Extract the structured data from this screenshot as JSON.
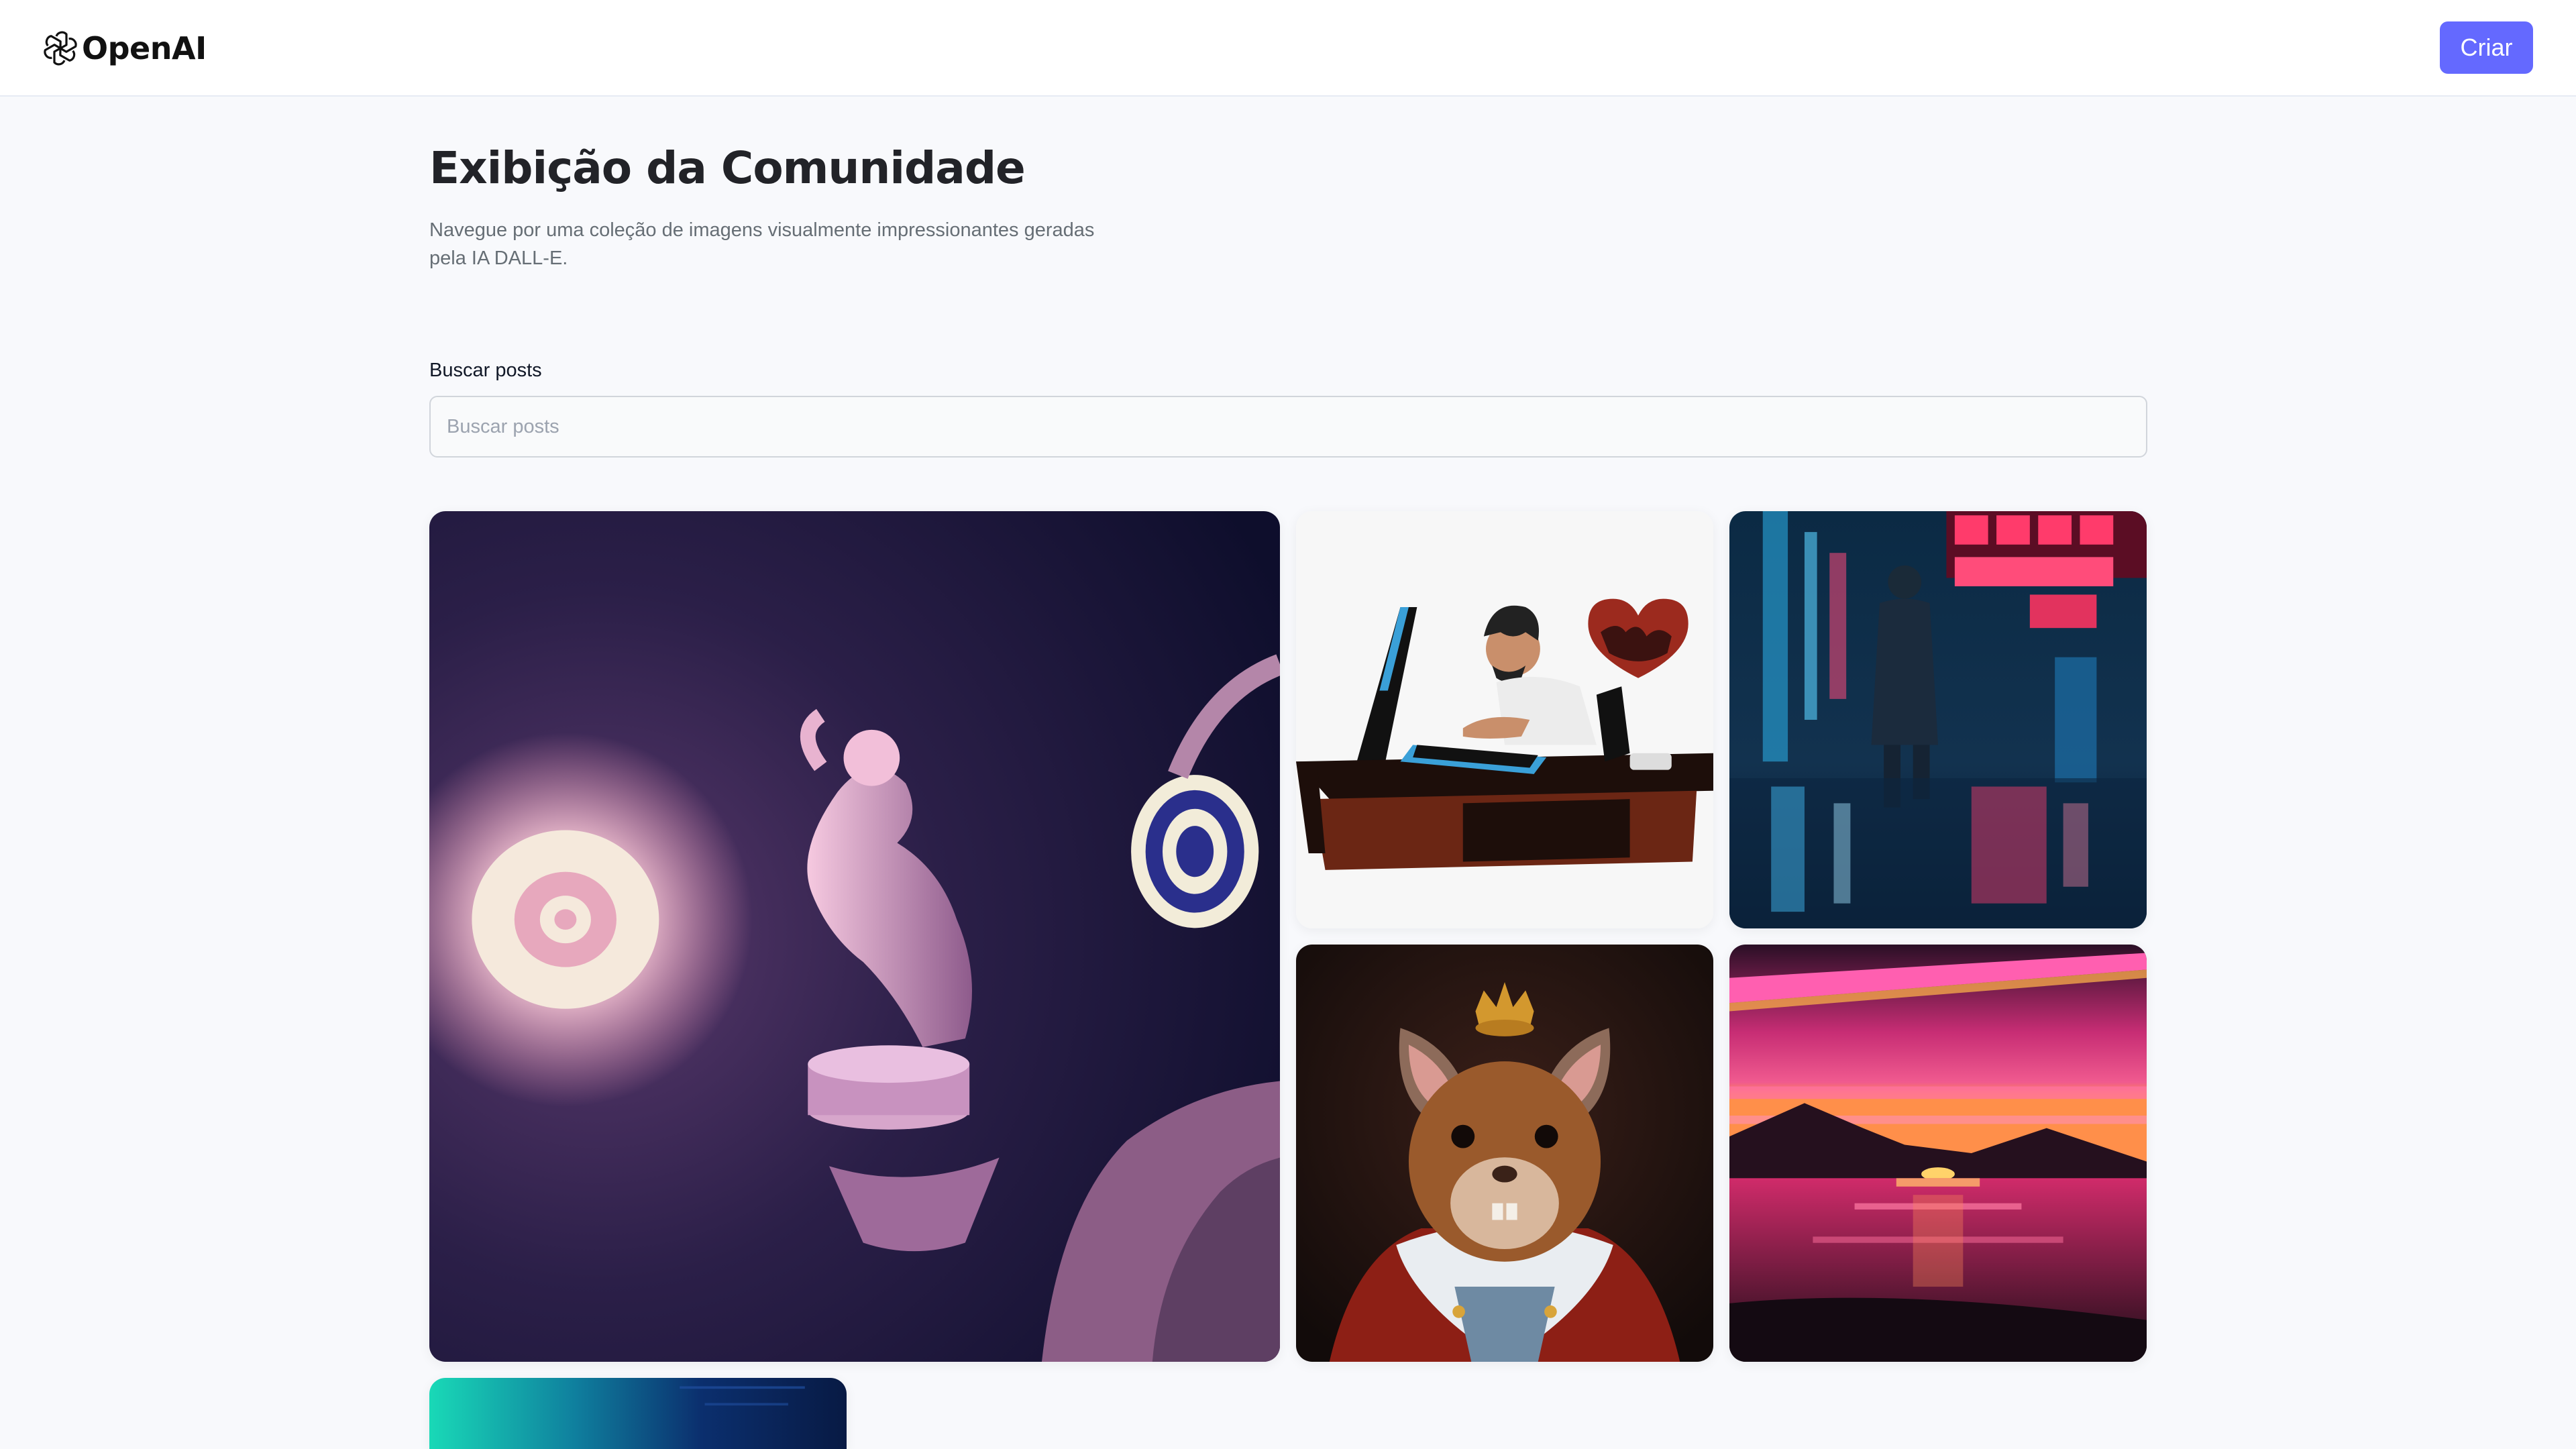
{
  "header": {
    "logo_text": "OpenAI",
    "create_label": "Criar"
  },
  "hero": {
    "title": "Exibição da Comunidade",
    "subtitle": "Navegue por uma coleção de imagens visualmente impressionantes geradas pela IA DALL-E."
  },
  "search": {
    "label": "Buscar posts",
    "placeholder": "Buscar posts",
    "value": ""
  },
  "colors": {
    "accent": "#6469ff",
    "page_background": "#f8f9fc",
    "title": "#222328",
    "subtitle": "#666e75"
  },
  "gallery": {
    "cards": [
      {
        "name": "figurine-glow-image"
      },
      {
        "name": "man-at-computer-image"
      },
      {
        "name": "rainy-neon-street-image"
      },
      {
        "name": "crowned-hamster-image"
      },
      {
        "name": "pink-sunset-lake-image"
      },
      {
        "name": "teal-gradient-image"
      }
    ]
  }
}
